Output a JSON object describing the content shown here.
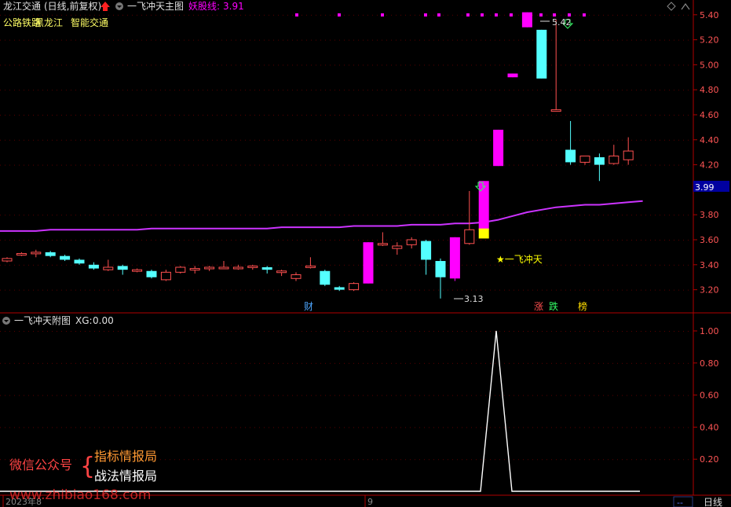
{
  "main_header": {
    "stock_name": "龙江交通",
    "period_label": "(日线,前复权)",
    "indicator_name": "一飞冲天主图",
    "line_label": "妖股线:",
    "line_value": "3.91"
  },
  "sectors": {
    "s1": "公路铁路",
    "s2": "黑龙江",
    "s3": "智能交通"
  },
  "sub_header": {
    "name": "一飞冲天附图",
    "xg_label": "XG:",
    "xg_value": "0.00"
  },
  "price_axis": [
    "5.40",
    "5.20",
    "5.00",
    "4.80",
    "4.60",
    "4.40",
    "4.20",
    "3.80",
    "3.60",
    "3.40",
    "3.20"
  ],
  "current_price": "3.99",
  "sub_axis": [
    "1.00",
    "0.80",
    "0.60",
    "0.40",
    "0.20"
  ],
  "annotations": {
    "high": "5.42",
    "low": "3.13",
    "signal": "★一飞冲天",
    "cai": "财",
    "zhang": "涨",
    "die": "跌",
    "bang": "榜"
  },
  "date_axis": {
    "d1": "2023年8",
    "d2": "9"
  },
  "bottom_bar": {
    "dashes": "--",
    "period": "日线"
  },
  "watermark": {
    "prefix": "微信公众号",
    "line1": "指标情报局",
    "line2": "战法情报局",
    "url": "www.zhibiao168.com"
  },
  "colors": {
    "up": "#ff5050",
    "down": "#54ffff",
    "yao": "#ff00ff",
    "star": "#ffff00",
    "axis": "#b00000"
  },
  "chart_data": {
    "type": "candlestick",
    "series": [
      {
        "o": 3.43,
        "h": 3.46,
        "l": 3.42,
        "c": 3.45
      },
      {
        "o": 3.48,
        "h": 3.5,
        "l": 3.47,
        "c": 3.49
      },
      {
        "o": 3.5,
        "h": 3.52,
        "l": 3.46,
        "c": 3.5
      },
      {
        "o": 3.5,
        "h": 3.51,
        "l": 3.46,
        "c": 3.47
      },
      {
        "o": 3.47,
        "h": 3.48,
        "l": 3.43,
        "c": 3.44
      },
      {
        "o": 3.44,
        "h": 3.45,
        "l": 3.4,
        "c": 3.41
      },
      {
        "o": 3.4,
        "h": 3.42,
        "l": 3.36,
        "c": 3.37
      },
      {
        "o": 3.36,
        "h": 3.44,
        "l": 3.35,
        "c": 3.38
      },
      {
        "o": 3.39,
        "h": 3.4,
        "l": 3.32,
        "c": 3.36
      },
      {
        "o": 3.35,
        "h": 3.37,
        "l": 3.34,
        "c": 3.36
      },
      {
        "o": 3.35,
        "h": 3.36,
        "l": 3.29,
        "c": 3.3
      },
      {
        "o": 3.28,
        "h": 3.36,
        "l": 3.27,
        "c": 3.34
      },
      {
        "o": 3.34,
        "h": 3.39,
        "l": 3.33,
        "c": 3.38
      },
      {
        "o": 3.37,
        "h": 3.39,
        "l": 3.33,
        "c": 3.37
      },
      {
        "o": 3.37,
        "h": 3.39,
        "l": 3.35,
        "c": 3.38
      },
      {
        "o": 3.38,
        "h": 3.43,
        "l": 3.37,
        "c": 3.38
      },
      {
        "o": 3.38,
        "h": 3.4,
        "l": 3.36,
        "c": 3.38
      },
      {
        "o": 3.38,
        "h": 3.4,
        "l": 3.36,
        "c": 3.39
      },
      {
        "o": 3.38,
        "h": 3.39,
        "l": 3.33,
        "c": 3.36
      },
      {
        "o": 3.34,
        "h": 3.36,
        "l": 3.31,
        "c": 3.35
      },
      {
        "o": 3.29,
        "h": 3.34,
        "l": 3.27,
        "c": 3.32
      },
      {
        "o": 3.38,
        "h": 3.46,
        "l": 3.37,
        "c": 3.39
      },
      {
        "o": 3.35,
        "h": 3.36,
        "l": 3.23,
        "c": 3.24
      },
      {
        "o": 3.22,
        "h": 3.23,
        "l": 3.19,
        "c": 3.2
      },
      {
        "o": 3.2,
        "h": 3.26,
        "l": 3.19,
        "c": 3.25
      },
      {
        "o": 3.25,
        "h": 3.58,
        "l": 3.25,
        "c": 3.58,
        "yao": true
      },
      {
        "o": 3.56,
        "h": 3.66,
        "l": 3.55,
        "c": 3.57
      },
      {
        "o": 3.53,
        "h": 3.58,
        "l": 3.48,
        "c": 3.55
      },
      {
        "o": 3.56,
        "h": 3.62,
        "l": 3.53,
        "c": 3.6
      },
      {
        "o": 3.59,
        "h": 3.6,
        "l": 3.32,
        "c": 3.44
      },
      {
        "o": 3.43,
        "h": 3.45,
        "l": 3.13,
        "c": 3.3
      },
      {
        "o": 3.29,
        "h": 3.62,
        "l": 3.27,
        "c": 3.62,
        "yao": true
      },
      {
        "o": 3.57,
        "h": 3.99,
        "l": 3.56,
        "c": 3.68
      },
      {
        "o": 3.68,
        "h": 4.07,
        "l": 3.66,
        "c": 4.07,
        "yao": true,
        "star": true
      },
      {
        "o": 4.19,
        "h": 4.48,
        "l": 4.19,
        "c": 4.48,
        "yao": true
      },
      {
        "o": 4.9,
        "h": 4.93,
        "l": 4.9,
        "c": 4.93,
        "yao": true
      },
      {
        "o": 5.3,
        "h": 5.42,
        "l": 5.3,
        "c": 5.42,
        "yao": true
      },
      {
        "o": 5.28,
        "h": 5.28,
        "l": 4.89,
        "c": 4.89
      },
      {
        "o": 4.64,
        "h": 5.36,
        "l": 4.64,
        "c": 4.64
      },
      {
        "o": 4.32,
        "h": 4.55,
        "l": 4.2,
        "c": 4.22
      },
      {
        "o": 4.22,
        "h": 4.27,
        "l": 4.2,
        "c": 4.27
      },
      {
        "o": 4.26,
        "h": 4.29,
        "l": 4.07,
        "c": 4.2
      },
      {
        "o": 4.21,
        "h": 4.36,
        "l": 4.2,
        "c": 4.27
      },
      {
        "o": 4.24,
        "h": 4.42,
        "l": 4.2,
        "c": 4.31
      }
    ],
    "ma_line": [
      3.67,
      3.67,
      3.67,
      3.68,
      3.68,
      3.68,
      3.68,
      3.68,
      3.68,
      3.68,
      3.69,
      3.69,
      3.69,
      3.69,
      3.69,
      3.69,
      3.69,
      3.69,
      3.69,
      3.7,
      3.7,
      3.7,
      3.7,
      3.7,
      3.71,
      3.71,
      3.71,
      3.71,
      3.72,
      3.72,
      3.72,
      3.73,
      3.73,
      3.74,
      3.76,
      3.79,
      3.82,
      3.84,
      3.86,
      3.87,
      3.88,
      3.88,
      3.89,
      3.9,
      3.91
    ],
    "xg": [
      0,
      0,
      0,
      0,
      0,
      0,
      0,
      0,
      0,
      0,
      0,
      0,
      0,
      0,
      0,
      0,
      0,
      0,
      0,
      0,
      0,
      0,
      0,
      0,
      0,
      0,
      0,
      0,
      0,
      0,
      0,
      0,
      0,
      0,
      0,
      0,
      1,
      0,
      0,
      0,
      0,
      0,
      0,
      0,
      0,
      0
    ]
  }
}
